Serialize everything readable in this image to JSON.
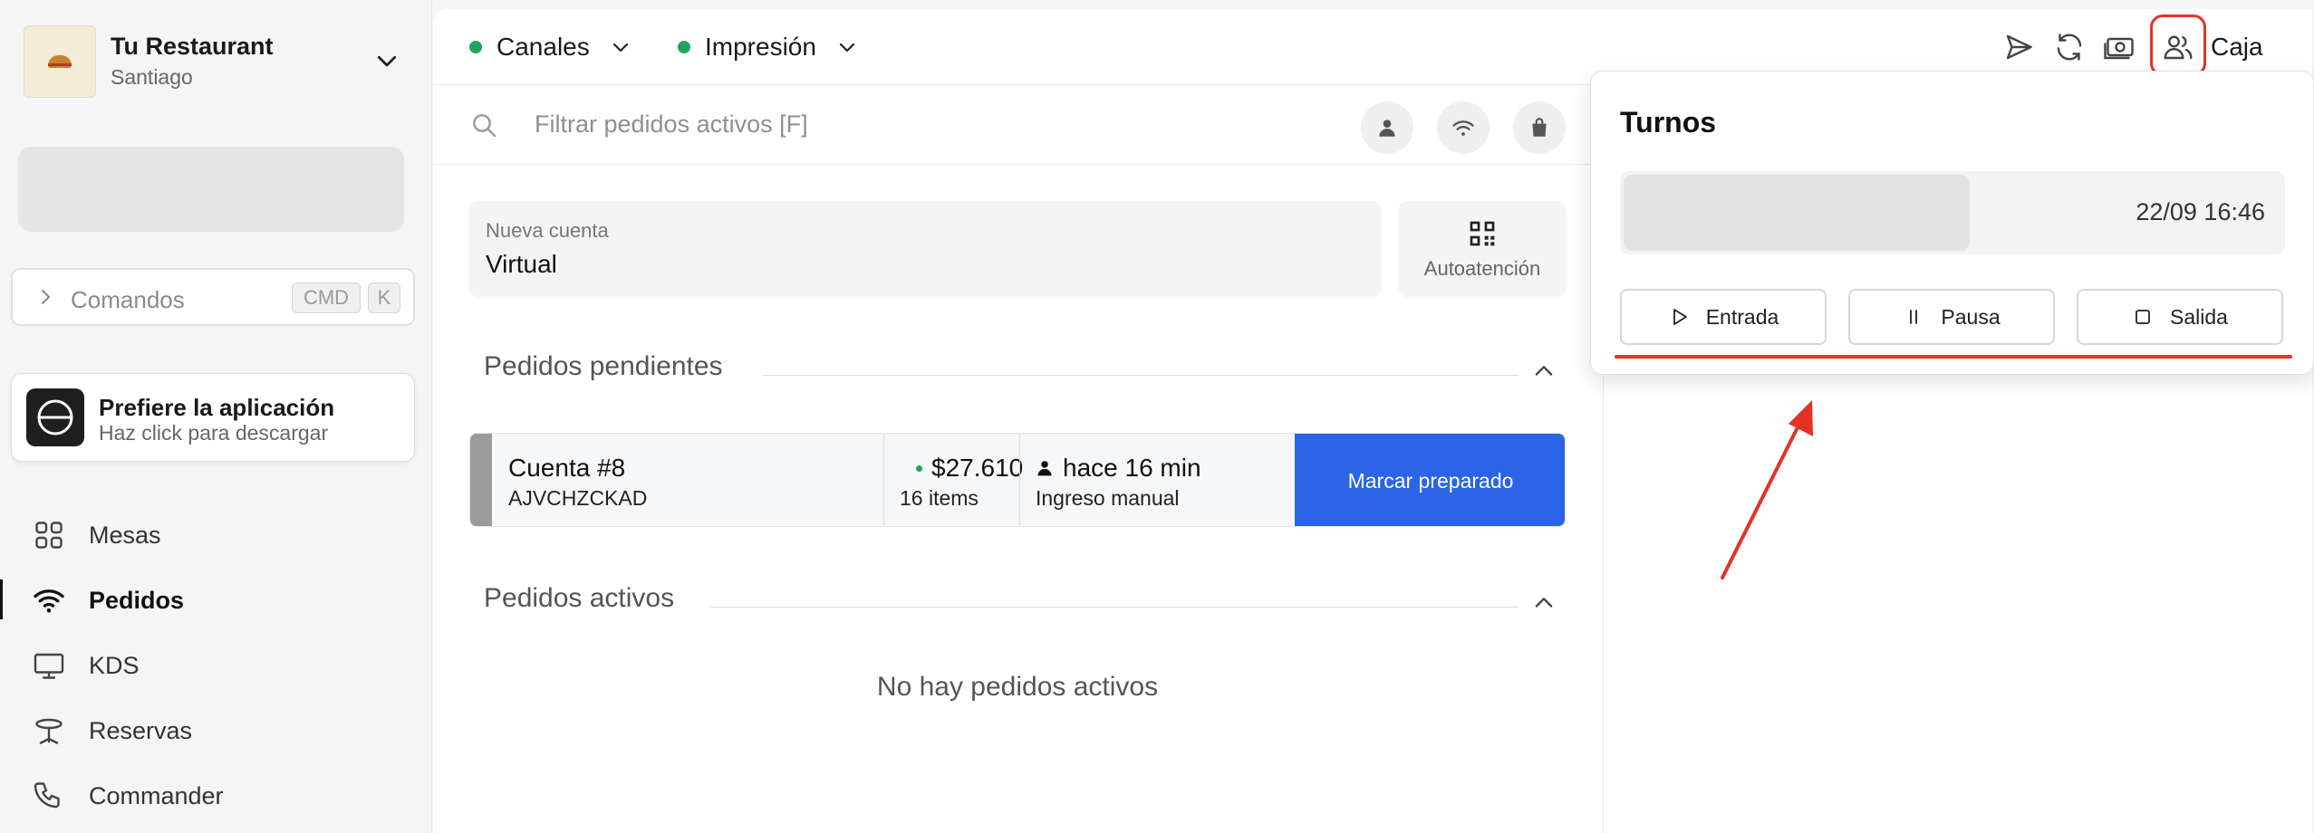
{
  "brand": {
    "name": "Tu Restaurant",
    "city": "Santiago"
  },
  "commands": {
    "label": "Comandos",
    "kbd_cmd": "CMD",
    "kbd_k": "K"
  },
  "app_promo": {
    "title": "Prefiere la aplicación",
    "subtitle": "Haz click para descargar"
  },
  "nav": {
    "items": [
      {
        "label": "Mesas",
        "icon": "grid-icon",
        "active": false
      },
      {
        "label": "Pedidos",
        "icon": "wifi-icon",
        "active": true
      },
      {
        "label": "KDS",
        "icon": "monitor-icon",
        "active": false
      },
      {
        "label": "Reservas",
        "icon": "table-icon",
        "active": false
      },
      {
        "label": "Commander",
        "icon": "phone-icon",
        "active": false
      }
    ]
  },
  "topbar": {
    "channels_label": "Canales",
    "print_label": "Impresión",
    "caja_label": "Caja",
    "status_color": "#22a45d"
  },
  "search": {
    "placeholder": "Filtrar pedidos activos [F]"
  },
  "new_account": {
    "caption": "Nueva cuenta",
    "value": "Virtual"
  },
  "self_service": {
    "label": "Autoatención"
  },
  "pending": {
    "title": "Pedidos pendientes",
    "orders": [
      {
        "account": "Cuenta #8",
        "code": "AJVCHZCKAD",
        "amount": "$27.610",
        "items": "16 items",
        "time": "hace 16 min",
        "source": "Ingreso manual",
        "action": "Marcar preparado"
      }
    ]
  },
  "active": {
    "title": "Pedidos activos",
    "empty": "No hay pedidos activos"
  },
  "shifts_popover": {
    "title": "Turnos",
    "shift_time": "22/09 16:46",
    "buttons": {
      "entrada": "Entrada",
      "pausa": "Pausa",
      "salida": "Salida"
    }
  },
  "colors": {
    "accent": "#2b64e6",
    "annotation": "#e53225",
    "status": "#22a45d"
  }
}
